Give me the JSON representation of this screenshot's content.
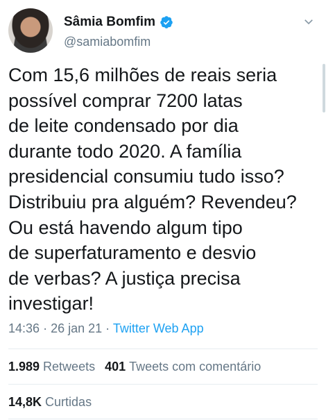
{
  "author": {
    "name": "Sâmia Bomfim",
    "handle": "@samiabomfim",
    "verified": true
  },
  "tweet": {
    "text": "Com 15,6 milhões de reais seria\npossível comprar 7200 latas\nde leite condensado por dia\ndurante todo 2020. A família\npresidencial consumiu tudo isso?\nDistribuiu pra alguém? Revendeu?\nOu está havendo algum tipo\nde superfaturamento e desvio\nde verbas? A justiça precisa\ninvestigar!",
    "time": "14:36",
    "date": "26 jan 21",
    "separator": "·",
    "source": "Twitter Web App"
  },
  "stats": {
    "retweets_count": "1.989",
    "retweets_label": "Retweets",
    "quotes_count": "401",
    "quotes_label": "Tweets com comentário",
    "likes_count": "14,8K",
    "likes_label": "Curtidas"
  },
  "colors": {
    "text": "#14171a",
    "secondary": "#657786",
    "accent": "#1da1f2",
    "divider": "#e6ecf0"
  },
  "icons": {
    "verified": "verified-badge-icon",
    "menu": "chevron-down-icon"
  }
}
